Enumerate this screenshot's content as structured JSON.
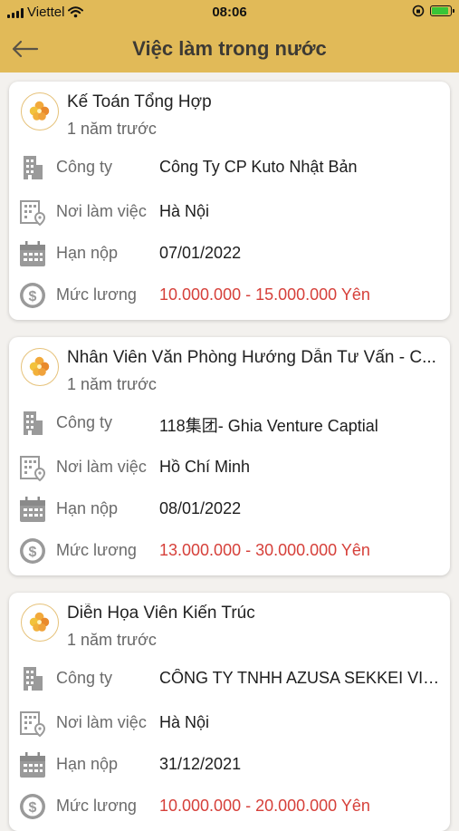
{
  "status_bar": {
    "carrier": "Viettel",
    "time": "08:06"
  },
  "header": {
    "title": "Việc làm trong nước"
  },
  "labels": {
    "company": "Công ty",
    "location": "Nơi làm việc",
    "deadline": "Hạn nộp",
    "salary": "Mức lương"
  },
  "jobs": [
    {
      "title": "Kế Toán Tổng Hợp",
      "posted": "1 năm trước",
      "company": "Công Ty CP Kuto Nhật Bản",
      "location": "Hà Nội",
      "deadline": "07/01/2022",
      "salary": "10.000.000 - 15.000.000 Yên"
    },
    {
      "title": "Nhân Viên Văn Phòng Hướng Dẫn Tư Vấn - C...",
      "posted": "1 năm trước",
      "company": "118集团- Ghia Venture Captial",
      "location": "Hồ Chí Minh",
      "deadline": "08/01/2022",
      "salary": "13.000.000 - 30.000.000 Yên"
    },
    {
      "title": "Diễn Họa Viên Kiến Trúc",
      "posted": "1 năm trước",
      "company": "CÔNG TY TNHH AZUSA SEKKEI VIE...",
      "location": "Hà Nội",
      "deadline": "31/12/2021",
      "salary": "10.000.000 - 20.000.000 Yên"
    }
  ],
  "colors": {
    "header_bg": "#e1ba58",
    "salary": "#d6403a",
    "icon_gray": "#9a9a9a"
  }
}
